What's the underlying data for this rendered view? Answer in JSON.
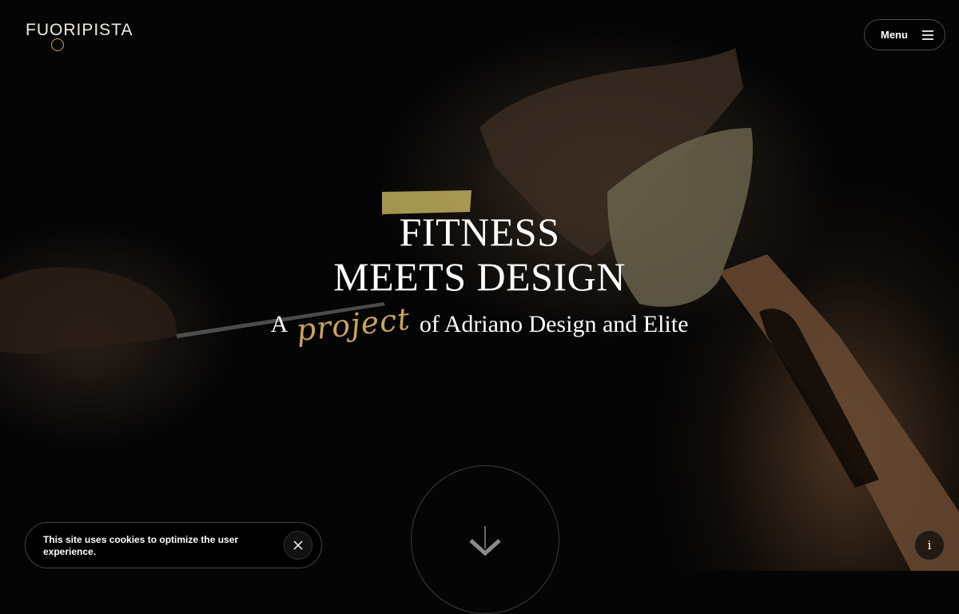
{
  "brand": {
    "logo_text": "FUORIPISTA",
    "accent_color": "#c9a45c"
  },
  "header": {
    "menu_label": "Menu",
    "menu_icon": "hamburger-icon"
  },
  "hero": {
    "headline_line1": "FITNESS",
    "headline_line2": "MEETS DESIGN",
    "tagline_prefix": "A",
    "tagline_script": "project",
    "tagline_suffix": "of Adriano Design and Elite",
    "scroll_icon": "arrow-down-icon"
  },
  "cookie": {
    "message": "This site uses cookies to optimize the user experience.",
    "close_icon": "close-icon"
  },
  "info": {
    "label": "i"
  }
}
